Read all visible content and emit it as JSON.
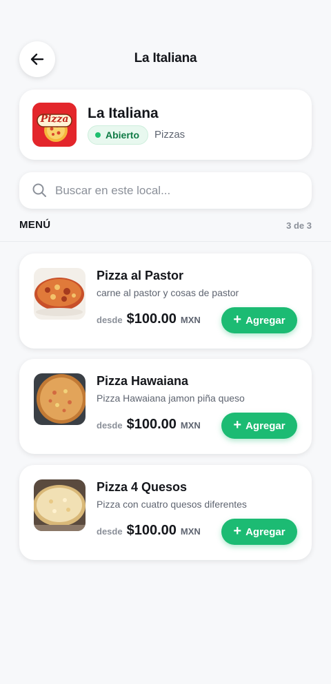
{
  "header": {
    "title": "La Italiana",
    "back_icon": "arrow-left-icon"
  },
  "store": {
    "name": "La Italiana",
    "logo_text": "Pizza",
    "status": "Abierto",
    "category": "Pizzas",
    "colors": {
      "logo_bg": "#e3262b",
      "status_green": "#1fbf6f"
    }
  },
  "search": {
    "placeholder": "Buscar en este local...",
    "value": ""
  },
  "menu": {
    "title": "MENÚ",
    "count": "3 de 3",
    "items": [
      {
        "name": "Pizza al Pastor",
        "description": "carne al pastor y cosas de pastor",
        "price_prefix": "desde",
        "price": "$100.00",
        "currency": "MXN",
        "add_label": "Agregar"
      },
      {
        "name": "Pizza Hawaiana",
        "description": "Pizza Hawaiana jamon piña queso",
        "price_prefix": "desde",
        "price": "$100.00",
        "currency": "MXN",
        "add_label": "Agregar"
      },
      {
        "name": "Pizza 4 Quesos",
        "description": "Pizza con cuatro quesos diferentes",
        "price_prefix": "desde",
        "price": "$100.00",
        "currency": "MXN",
        "add_label": "Agregar"
      }
    ]
  },
  "accent_color": "#1cbb73"
}
